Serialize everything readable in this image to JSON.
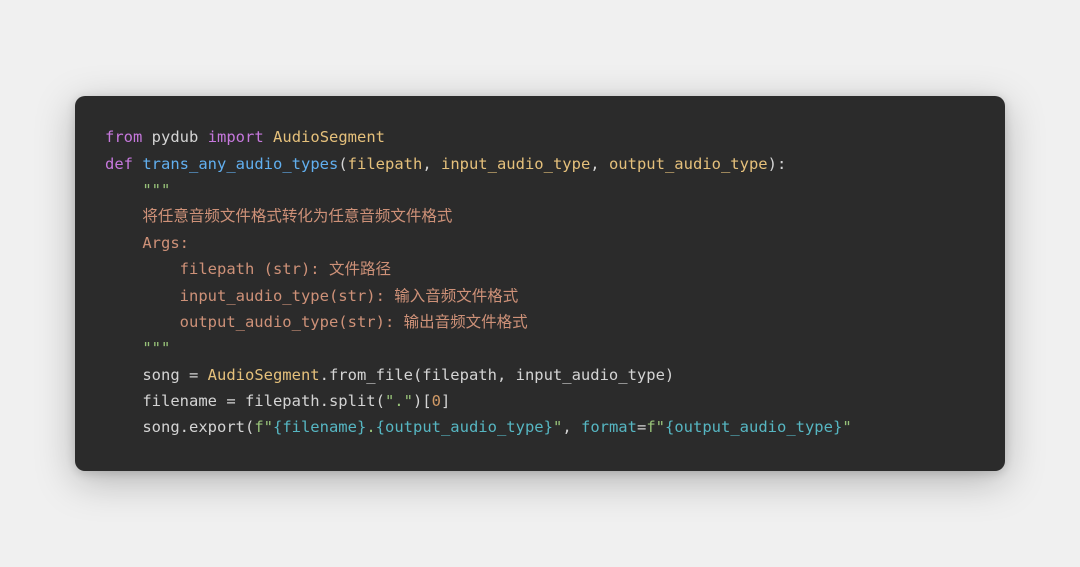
{
  "code": {
    "line1": {
      "kw_from": "from",
      "module": "pydub",
      "kw_import": "import",
      "class": "AudioSegment"
    },
    "line2": {
      "kw_def": "def",
      "func": "trans_any_audio_types",
      "open": "(",
      "p1": "filepath",
      "c1": ", ",
      "p2": "input_audio_type",
      "c2": ", ",
      "p3": "output_audio_type",
      "close": "):"
    },
    "doc": {
      "q1": "    \"\"\"",
      "l1": "    将任意音频文件格式转化为任意音频文件格式",
      "l2": "    Args:",
      "l3": "        filepath (str): 文件路径",
      "l4": "        input_audio_type(str): 输入音频文件格式",
      "l5": "        output_audio_type(str): 输出音频文件格式",
      "q2": "    \"\"\""
    },
    "body": {
      "b1a": "    song = ",
      "b1b": "AudioSegment",
      "b1c": ".from_file(filepath, input_audio_type)",
      "b2a": "    filename = filepath.split(",
      "b2b": "\".\"",
      "b2c": ")[",
      "b2d": "0",
      "b2e": "]",
      "b3a": "    song.export(",
      "b3b": "f\"",
      "b3c": "{filename}",
      "b3d": ".",
      "b3e": "{output_audio_type}",
      "b3f": "\"",
      "b3g": ", ",
      "b3h": "format",
      "b3i": "=",
      "b3j": "f\"",
      "b3k": "{output_audio_type}",
      "b3l": "\""
    }
  }
}
